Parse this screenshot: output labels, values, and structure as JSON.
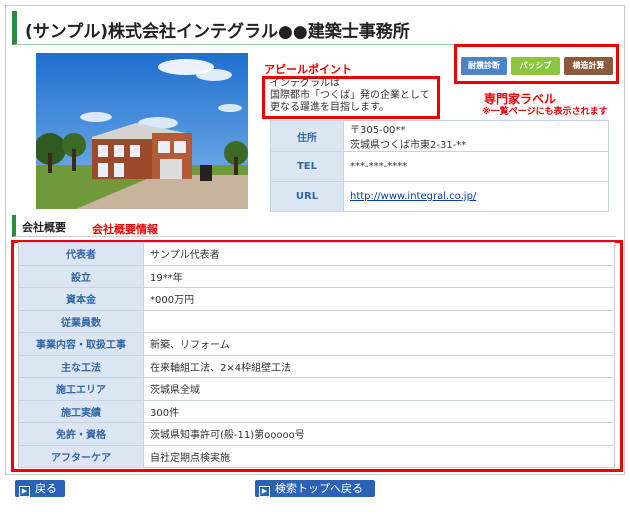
{
  "page": {
    "title": "(サンプル)株式会社インテグラル●●建築士事務所"
  },
  "annotations": {
    "appeal_point": "アピールポイント",
    "expert_label": "専門家ラベル",
    "expert_label_note": "※一覧ページにも表示されます",
    "company_info": "会社概要情報"
  },
  "appeal": {
    "lines": [
      "インテグラルは",
      "国際都市「つくば」発の企業として",
      "更なる躍進を目指します。"
    ]
  },
  "badges": [
    {
      "label": "耐震診断",
      "color": "#4a84c4"
    },
    {
      "label": "パッシブ",
      "color": "#8cc63e"
    },
    {
      "label": "構造計算",
      "color": "#8b5a3c"
    }
  ],
  "info": {
    "address_label": "住所",
    "address_line1": "〒305-00**",
    "address_line2": "茨城県つくば市東2-31-**",
    "tel_label": "TEL",
    "tel_value": "***-***-****",
    "url_label": "URL",
    "url_value": "http://www.integral.co.jp/"
  },
  "section": {
    "title": "会社概要"
  },
  "details": {
    "rows": [
      {
        "label": "代表者",
        "value": "サンプル代表者"
      },
      {
        "label": "設立",
        "value": "19**年"
      },
      {
        "label": "資本金",
        "value": "*000万円"
      },
      {
        "label": "従業員数",
        "value": ""
      },
      {
        "label": "事業内容・取扱工事",
        "value": "新築、リフォーム"
      },
      {
        "label": "主な工法",
        "value": "在来軸組工法、2×4枠組壁工法"
      },
      {
        "label": "施工エリア",
        "value": "茨城県全域"
      },
      {
        "label": "施工実績",
        "value": "300件"
      },
      {
        "label": "免許・資格",
        "value": "茨城県知事許可(般-11)第ooooo号"
      },
      {
        "label": "アフターケア",
        "value": "自社定期点検実施"
      }
    ]
  },
  "buttons": {
    "back": "戻る",
    "search_top": "検索トップへ戻る"
  },
  "colors": {
    "accent_green": "#2e8b3c",
    "annotation_red": "#e00000",
    "button_blue": "#2b62b3"
  }
}
